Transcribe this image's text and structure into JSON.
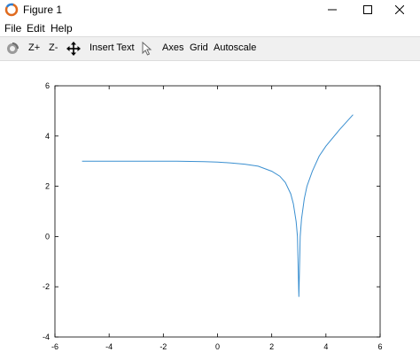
{
  "window": {
    "title": "Figure 1",
    "controls": [
      "minimize",
      "maximize",
      "close"
    ]
  },
  "menu": {
    "file": "File",
    "edit": "Edit",
    "help": "Help"
  },
  "toolbar": {
    "rotate_icon": "rotate-icon",
    "zoom_in": "Z+",
    "zoom_out": "Z-",
    "pan_icon": "pan-icon",
    "insert_text": "Insert Text",
    "select_icon": "cursor-icon",
    "axes": "Axes",
    "grid": "Grid",
    "autoscale": "Autoscale"
  },
  "chart_data": {
    "type": "line",
    "title": "",
    "xlabel": "",
    "ylabel": "",
    "xlim": [
      -6,
      6
    ],
    "ylim": [
      -4,
      6
    ],
    "xticks": [
      "-6",
      "-4",
      "-2",
      "0",
      "2",
      "4",
      "6"
    ],
    "yticks": [
      "-4",
      "-2",
      "0",
      "2",
      "4",
      "6"
    ],
    "grid": false,
    "line_color": "#3a8fd0",
    "series": [
      {
        "x": [
          -5,
          -4,
          -3,
          -2,
          -1.5,
          -1,
          -0.5,
          0,
          0.5,
          1,
          1.5,
          2,
          2.3,
          2.5,
          2.7,
          2.8,
          2.9,
          2.95,
          3.0,
          3.05,
          3.1,
          3.2,
          3.3,
          3.5,
          3.75,
          4,
          4.5,
          5
        ],
        "y": [
          3.0,
          3.0,
          3.0,
          3.0,
          3.0,
          2.99,
          2.98,
          2.96,
          2.93,
          2.88,
          2.8,
          2.6,
          2.4,
          2.15,
          1.7,
          1.3,
          0.6,
          0.0,
          -2.4,
          0.0,
          0.7,
          1.5,
          2.0,
          2.6,
          3.2,
          3.6,
          4.25,
          4.85
        ]
      }
    ]
  }
}
